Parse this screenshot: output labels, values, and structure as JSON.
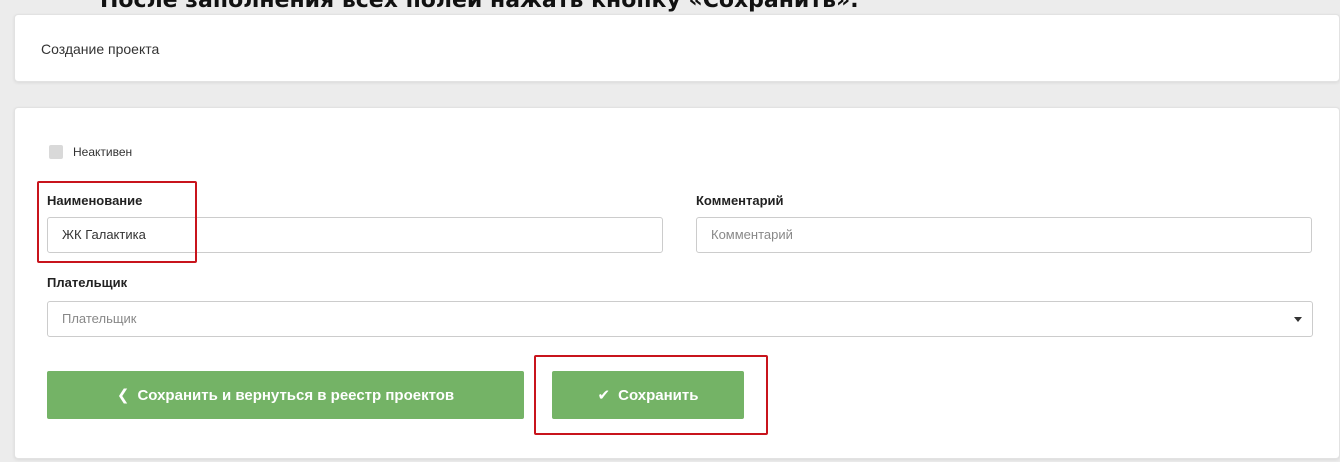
{
  "caption": "После заполнения всех полей нажать кнопку «Сохранить».",
  "header": {
    "title": "Создание проекта"
  },
  "form": {
    "inactive_label": "Неактивен",
    "name_label": "Наименование",
    "name_value": "ЖК Галактика",
    "comment_label": "Комментарий",
    "comment_placeholder": "Комментарий",
    "payer_label": "Плательщик",
    "payer_placeholder": "Плательщик"
  },
  "buttons": {
    "save_return": "Сохранить и вернуться в реестр проектов",
    "save": "Сохранить"
  },
  "colors": {
    "button_green": "#74b366",
    "highlight_red": "#c8141c"
  },
  "icons": {
    "back": "chevron-left-icon",
    "save": "check-icon",
    "dropdown": "caret-down-icon"
  }
}
